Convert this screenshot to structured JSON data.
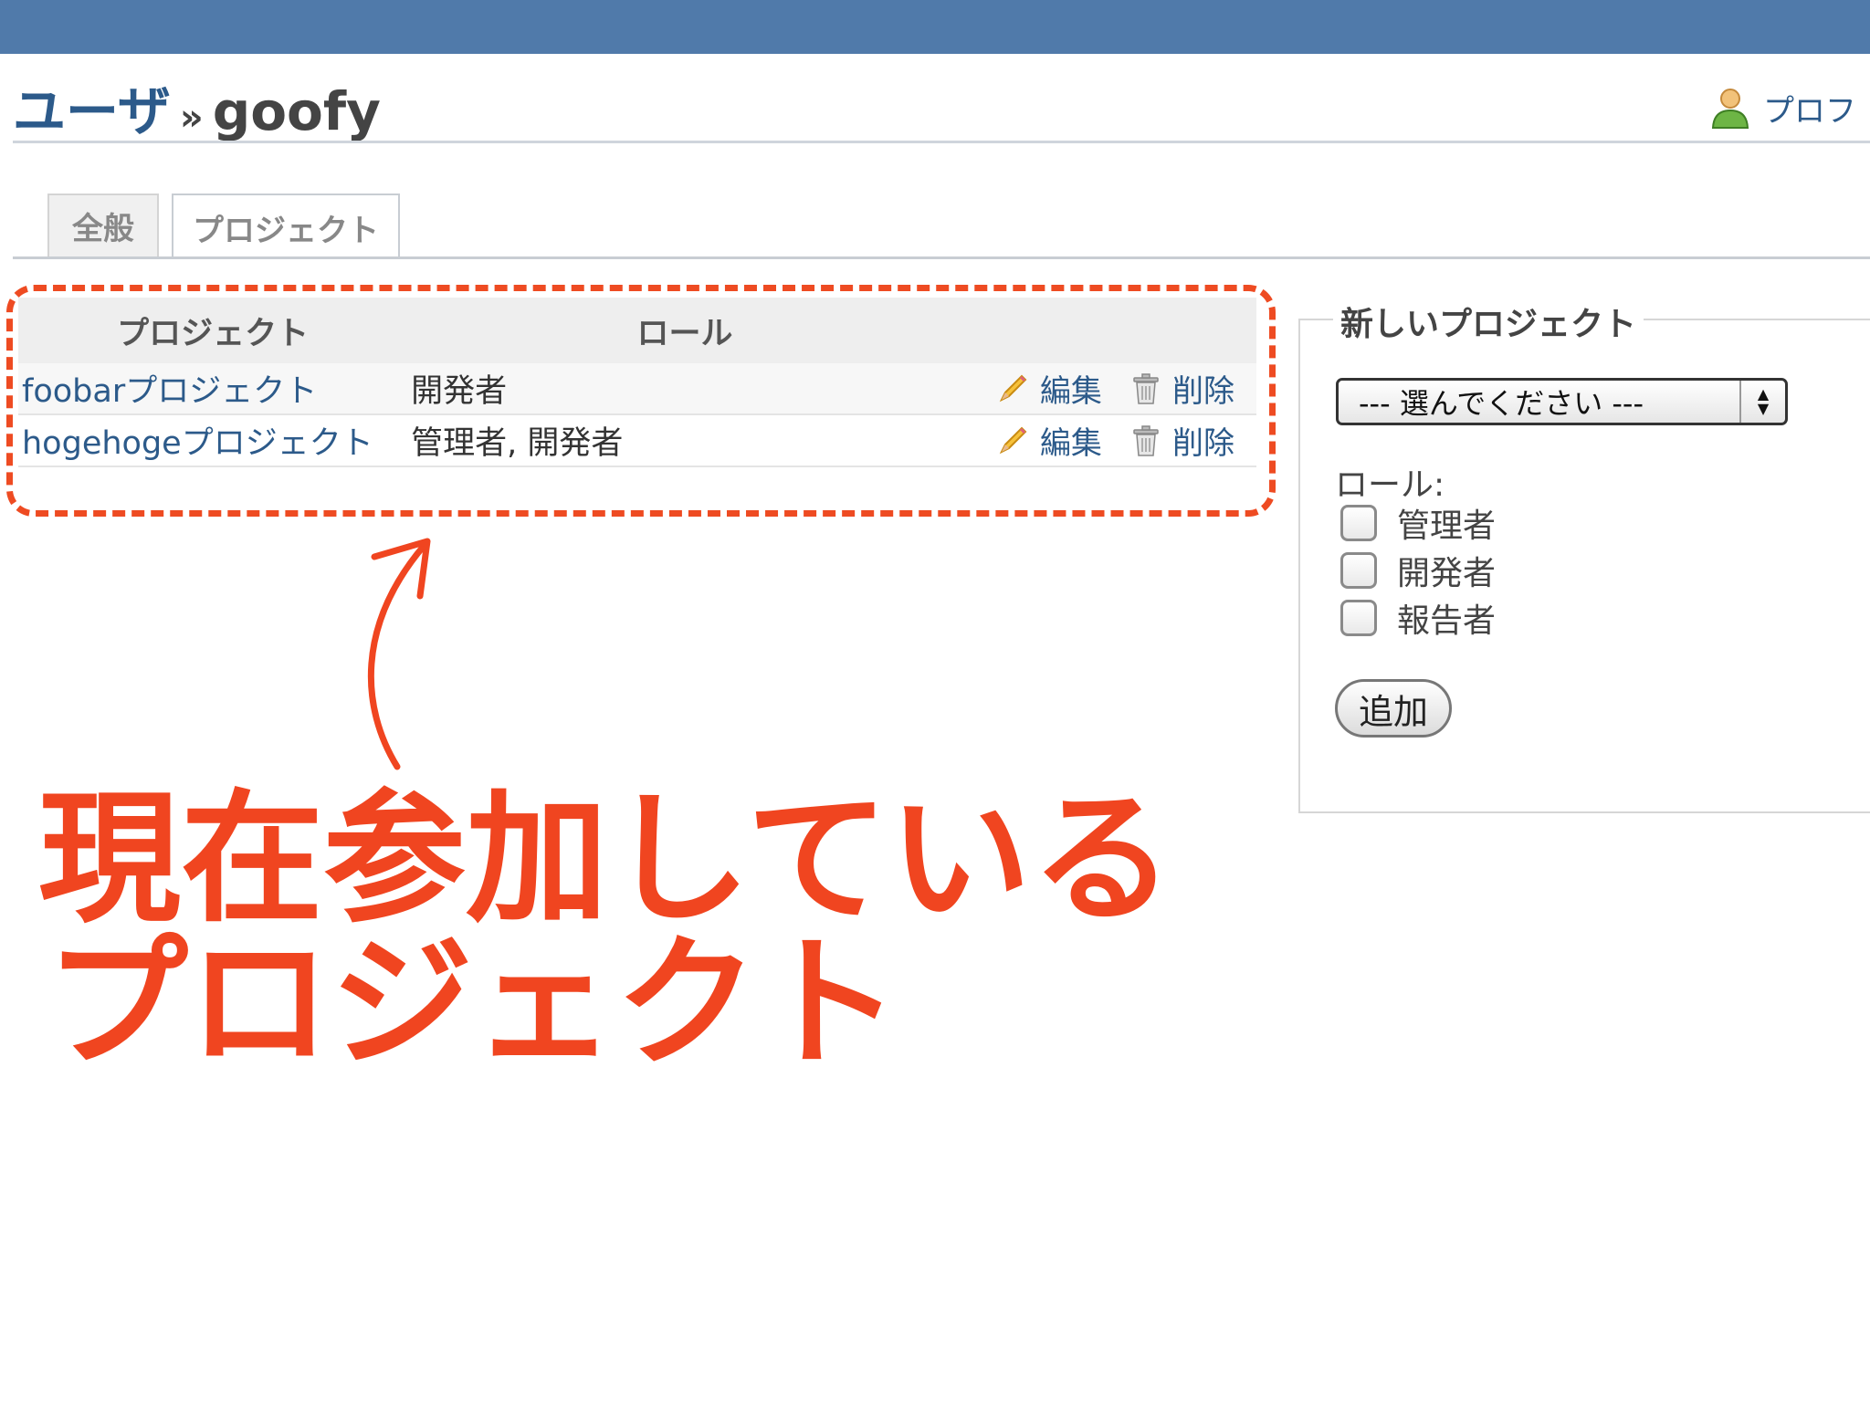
{
  "header": {
    "breadcrumb_parent": "ユーザ",
    "breadcrumb_separator": "»",
    "user_name": "goofy",
    "profile_link": "プロフ"
  },
  "tabs": [
    {
      "label": "全般"
    },
    {
      "label": "プロジェクト",
      "selected": true
    }
  ],
  "memberships": {
    "columns": [
      "プロジェクト",
      "ロール"
    ],
    "rows": [
      {
        "project": "foobarプロジェクト",
        "roles": "開発者",
        "edit": "編集",
        "delete": "削除"
      },
      {
        "project": "hogehogeプロジェクト",
        "roles": "管理者, 開発者",
        "edit": "編集",
        "delete": "削除"
      }
    ]
  },
  "new_project": {
    "legend": "新しいプロジェクト",
    "select_value": "--- 選んでください ---",
    "roles_label": "ロール:",
    "roles": [
      "管理者",
      "開発者",
      "報告者"
    ],
    "submit": "追加"
  },
  "annotation": {
    "line1": "現在参加している",
    "line2": "プロジェクト",
    "color": "#f04520"
  },
  "colors": {
    "topbar": "#507aaa",
    "link": "#2c5a8a"
  },
  "icons": {
    "profile": "user-icon",
    "edit": "pencil-icon",
    "delete": "trash-icon",
    "select": "up-down-arrows-icon"
  }
}
